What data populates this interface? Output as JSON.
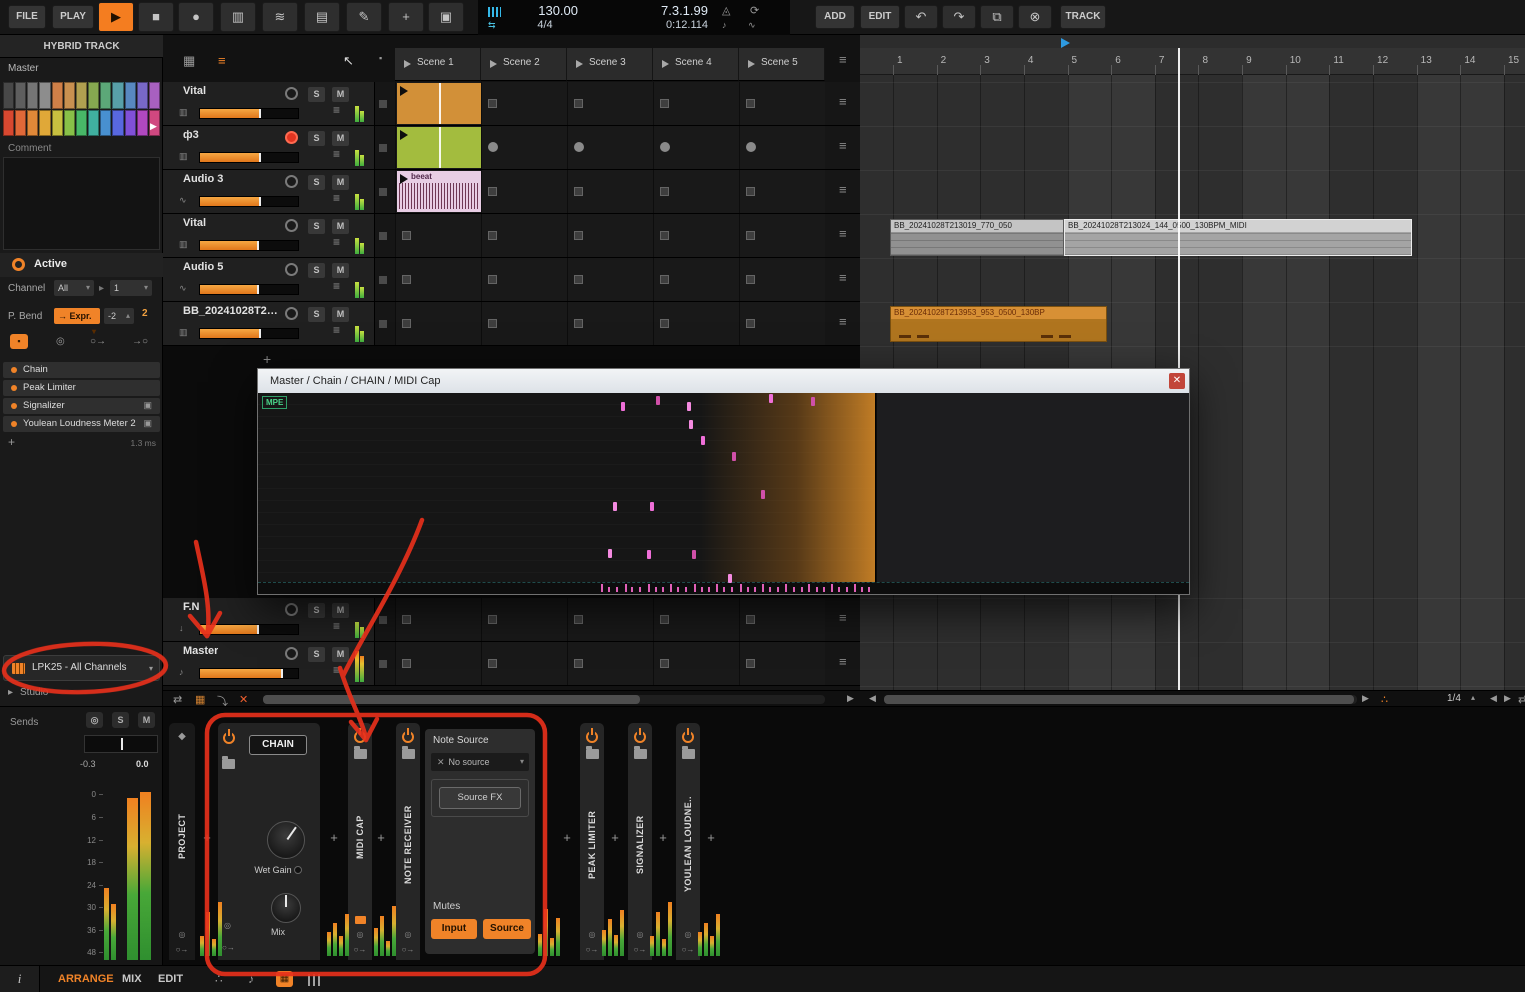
{
  "icons": {
    "play": "▶",
    "stop": "■",
    "record": "●",
    "pointer": "↖",
    "keys": "▥",
    "layers": "≋",
    "mixer": "▤",
    "pencil": "✎",
    "plus": "+",
    "clipbox": "▣",
    "undo": "↶",
    "redo": "↷",
    "copy": "⧉",
    "cancel": "⊗",
    "loop": "⟳",
    "metro": "◬",
    "note": "♪",
    "wave": "∿",
    "list": "≡",
    "grid": "▦",
    "square": "▪",
    "x": "✕",
    "swap": "⇄",
    "drop": "⤵",
    "arrow_r": "▶",
    "arrow_l": "◀",
    "caret": "▾",
    "caret_up": "▴",
    "tri": "▸",
    "diamond": "◆",
    "target": "◎",
    "routeout": "○→",
    "routein": "→○",
    "dots": "∴",
    "updown": "⇅",
    "shuffle": "⇆"
  },
  "toolbar": {
    "file": "FILE",
    "play": "PLAY",
    "add": "ADD",
    "edit": "EDIT",
    "track": "TRACK",
    "tempo": "130.00",
    "time_sig": "4/4",
    "position": "7.3.1.99",
    "time": "0:12.114"
  },
  "sidebar": {
    "header": "HYBRID TRACK",
    "master": "Master",
    "comment": "Comment",
    "active": "Active",
    "channel_label": "Channel",
    "channel_all": "All",
    "channel_num": "1",
    "pbend_label": "P. Bend",
    "pbend_mode": "→ Expr.",
    "pbend_min": "-2",
    "pbend_max": "2",
    "devices": [
      "Chain",
      "Peak Limiter",
      "Signalizer",
      "Youlean Loudness Meter 2"
    ],
    "latency": "1.3 ms",
    "controller": "LPK25 - All Channels",
    "studio": "Studio",
    "sends": "Sends",
    "meter": {
      "left": "-0.3",
      "right": "0.0",
      "scale": [
        "0",
        "6",
        "12",
        "18",
        "24",
        "30",
        "36",
        "48"
      ]
    },
    "palette": [
      "#484848",
      "#5e5e5e",
      "#757575",
      "#8d8d8d",
      "#d08048",
      "#c89050",
      "#b0a050",
      "#86a850",
      "#5ca878",
      "#58a0a8",
      "#5888c0",
      "#7868c8",
      "#a860c0",
      "#d84830",
      "#e06838",
      "#e08838",
      "#e0a838",
      "#c8c040",
      "#88c048",
      "#48b868",
      "#40b0a0",
      "#4890d0",
      "#5868e0",
      "#8050d8",
      "#b048c0",
      "#d04880"
    ]
  },
  "launcher": {
    "scenes": [
      "Scene 1",
      "Scene 2",
      "Scene 3",
      "Scene 4",
      "Scene 5"
    ],
    "tracks": [
      {
        "name": "Vital",
        "icon": "keys",
        "armed": false,
        "fill": 62,
        "slot": "square",
        "clip": {
          "type": "midi",
          "color": "#d29038"
        }
      },
      {
        "name": "ф3",
        "icon": "keys",
        "armed": true,
        "fill": 62,
        "slot": "circle",
        "clip": {
          "type": "midi",
          "color": "#a3bc3e"
        }
      },
      {
        "name": "Audio 3",
        "icon": "wave",
        "armed": false,
        "fill": 62,
        "slot": "square",
        "clip": {
          "type": "audio",
          "color": "#e8cde4",
          "label": "beeat"
        }
      },
      {
        "name": "Vital",
        "icon": "keys",
        "armed": false,
        "fill": 60,
        "slot": "square",
        "clip": null
      },
      {
        "name": "Audio 5",
        "icon": "wave",
        "armed": false,
        "fill": 60,
        "slot": "square",
        "clip": null
      },
      {
        "name": "BB_20241028T21...",
        "icon": "keys",
        "armed": false,
        "fill": 62,
        "slot": "square",
        "clip": null
      },
      {
        "name": "F.N",
        "icon": "down",
        "armed": false,
        "fill": 60,
        "slot": "square",
        "clip": null
      },
      {
        "name": "Master",
        "icon": "note",
        "armed": false,
        "fill": 85,
        "slot": "square",
        "clip": null
      }
    ]
  },
  "timeline": {
    "ruler": [
      "1",
      "2",
      "3",
      "4",
      "5",
      "6",
      "7",
      "8",
      "9",
      "10",
      "11",
      "12",
      "13",
      "14",
      "15"
    ],
    "clip_labels": [
      "BB_20241028T213019_770_050",
      "BB_20241028T213024_144_0500_130BPM_MIDI",
      "BB_20241028T213953_953_0500_130BP"
    ],
    "zoom": "1/4"
  },
  "editor": {
    "title": "Master / Chain / CHAIN / MIDI Cap",
    "mpe": "MPE",
    "close": "✕",
    "notes": [
      [
        363,
        9
      ],
      [
        398,
        3
      ],
      [
        429,
        9
      ],
      [
        511,
        1
      ],
      [
        553,
        4
      ],
      [
        431,
        27
      ],
      [
        443,
        43
      ],
      [
        474,
        59
      ],
      [
        355,
        109
      ],
      [
        392,
        109
      ],
      [
        503,
        97
      ],
      [
        350,
        156
      ],
      [
        389,
        157
      ],
      [
        434,
        157
      ],
      [
        470,
        181
      ]
    ],
    "ticks": [
      343,
      350,
      358,
      367,
      373,
      381,
      390,
      397,
      404,
      412,
      419,
      427,
      436,
      443,
      450,
      458,
      465,
      473,
      482,
      489,
      496,
      504,
      511,
      519,
      527,
      535,
      543,
      550,
      558,
      565,
      573,
      580,
      588,
      596,
      603,
      610
    ]
  },
  "device_panel": {
    "project": "PROJECT",
    "chain_title": "CHAIN",
    "wet_gain": "Wet Gain",
    "mix": "Mix",
    "midi_cap": "MIDI CAP",
    "note_receiver": "NOTE RECEIVER",
    "note_source_header": "Note Source",
    "no_source": "No source",
    "source_fx": "Source FX",
    "mutes": "Mutes",
    "input_btn": "Input",
    "source_btn": "Source",
    "peak_limiter": "PEAK LIMITER",
    "signalizer": "SIGNALIZER",
    "youlean": "YOULEAN LOUDNE.."
  },
  "status_bar": {
    "info": "i",
    "tabs": [
      "ARRANGE",
      "MIX",
      "EDIT"
    ]
  }
}
